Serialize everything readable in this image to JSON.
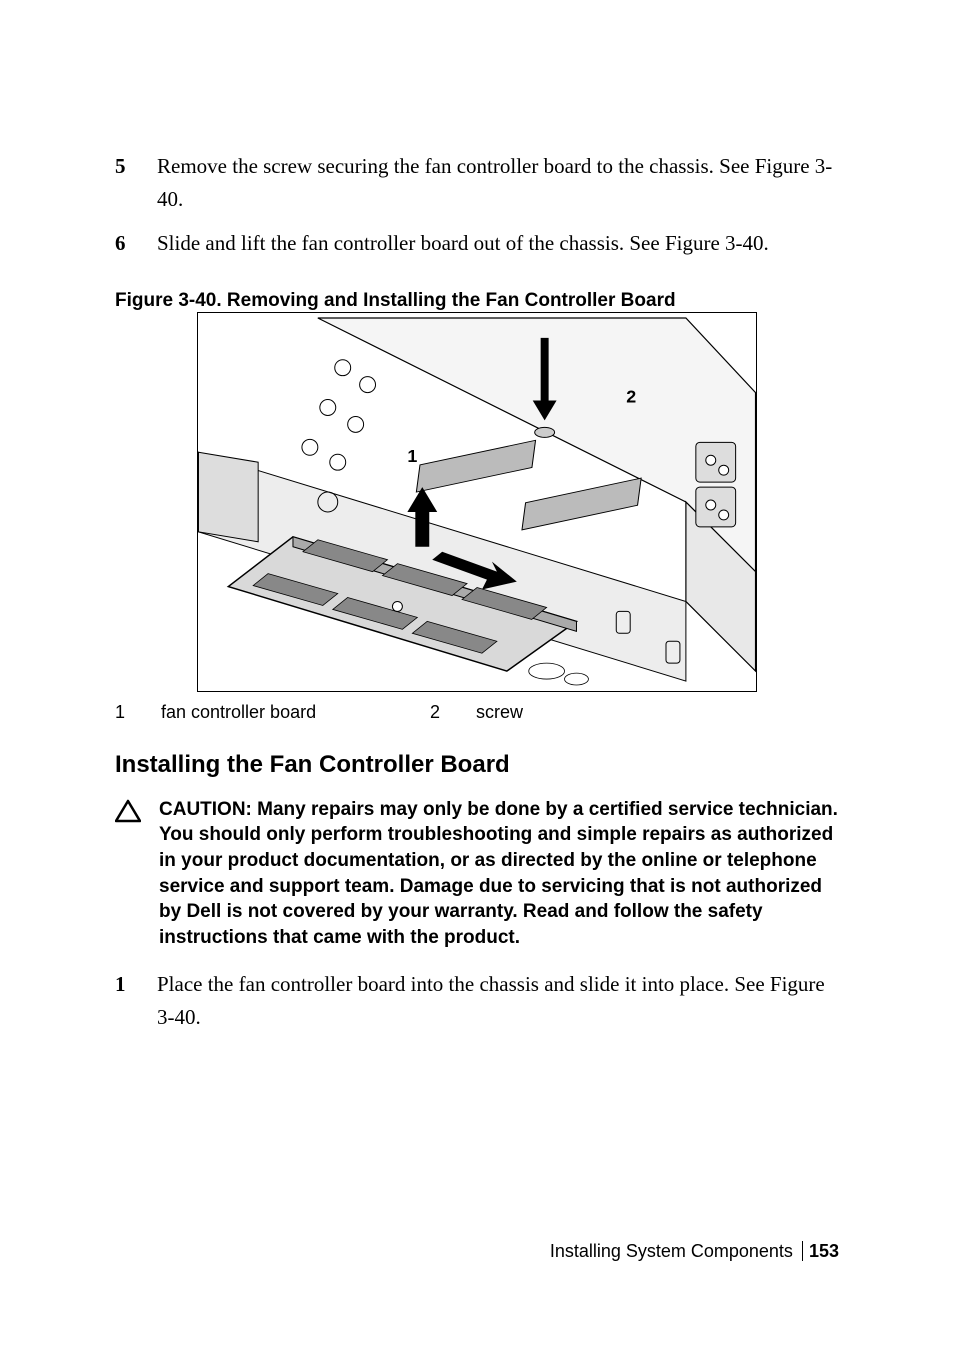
{
  "steps": {
    "five": {
      "num": "5",
      "text": "Remove the screw securing the fan controller board to the chassis. See Figure 3-40."
    },
    "six": {
      "num": "6",
      "text": "Slide and lift the fan controller board out of the chassis. See Figure 3-40."
    }
  },
  "figure": {
    "caption": "Figure 3-40.   Removing and Installing the Fan Controller Board",
    "callout1": "1",
    "callout2": "2"
  },
  "legend": {
    "item1": {
      "num": "1",
      "label": "fan controller board"
    },
    "item2": {
      "num": "2",
      "label": "screw"
    }
  },
  "section": {
    "heading": "Installing the Fan Controller Board"
  },
  "caution": {
    "text": "CAUTION: Many repairs may only be done by a certified service technician. You should only perform troubleshooting and simple repairs as authorized in your product documentation, or as directed by the online or telephone service and support team. Damage due to servicing that is not authorized by Dell is not covered by your warranty. Read and follow the safety instructions that came with the product."
  },
  "install": {
    "one": {
      "num": "1",
      "text": "Place the fan controller board into the chassis and slide it into place. See Figure 3-40."
    }
  },
  "footer": {
    "section": "Installing System Components",
    "page": "153"
  }
}
